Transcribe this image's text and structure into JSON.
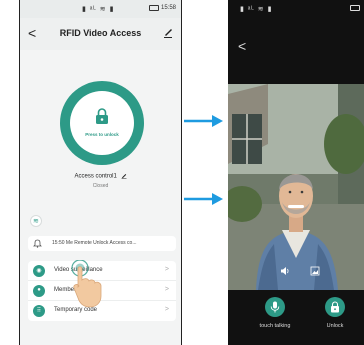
{
  "left_screen": {
    "status_time": "15:58",
    "status_signal": "▮ ᵃᴸ ≋ ▮",
    "title": "RFID Video Access",
    "press_to_unlock": "Press to unlock",
    "device_name": "Access control1",
    "device_status": "Closed",
    "notification": "15:50 Me  Remote Unlock Access co...",
    "menu_items": [
      {
        "label": "Video surveillance",
        "icon": "camera-icon"
      },
      {
        "label": "Member manage",
        "icon": "user-icon"
      },
      {
        "label": "Temporary code",
        "icon": "keypad-icon"
      }
    ]
  },
  "right_screen": {
    "status_signal": "▮ ᵃᴸ ≋ ▮",
    "talk_label": "touch talking",
    "unlock_label": "Unlock"
  },
  "colors": {
    "accent": "#2d9a87",
    "arrow": "#1e9be0"
  }
}
